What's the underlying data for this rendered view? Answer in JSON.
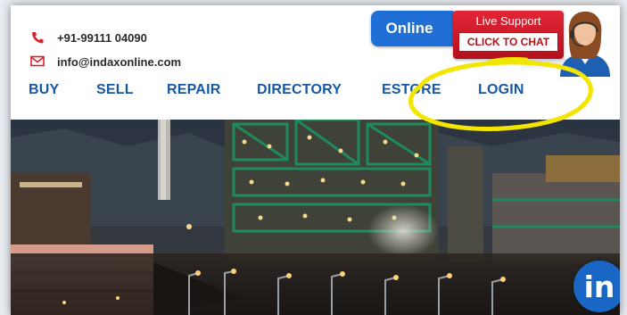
{
  "contact": {
    "phone": "+91-99111 04090",
    "email": "info@indaxonline.com"
  },
  "support": {
    "online_label": "Online",
    "live_title": "Live Support",
    "chat_label": "CLICK TO CHAT"
  },
  "nav": {
    "items": [
      "BUY",
      "SELL",
      "REPAIR",
      "DIRECTORY",
      "ESTORE",
      "LOGIN"
    ]
  },
  "social": {
    "linkedin_label": "in"
  },
  "icons": {
    "phone": "phone-icon",
    "email": "envelope-icon",
    "linkedin": "linkedin-icon"
  },
  "colors": {
    "nav_text": "#1658a5",
    "icon_red": "#d8232a",
    "online_blue": "#1f6fd6",
    "live_red": "#cc1a28",
    "linkedin_blue": "#1a66c4",
    "annotation_yellow": "#f2e600"
  }
}
